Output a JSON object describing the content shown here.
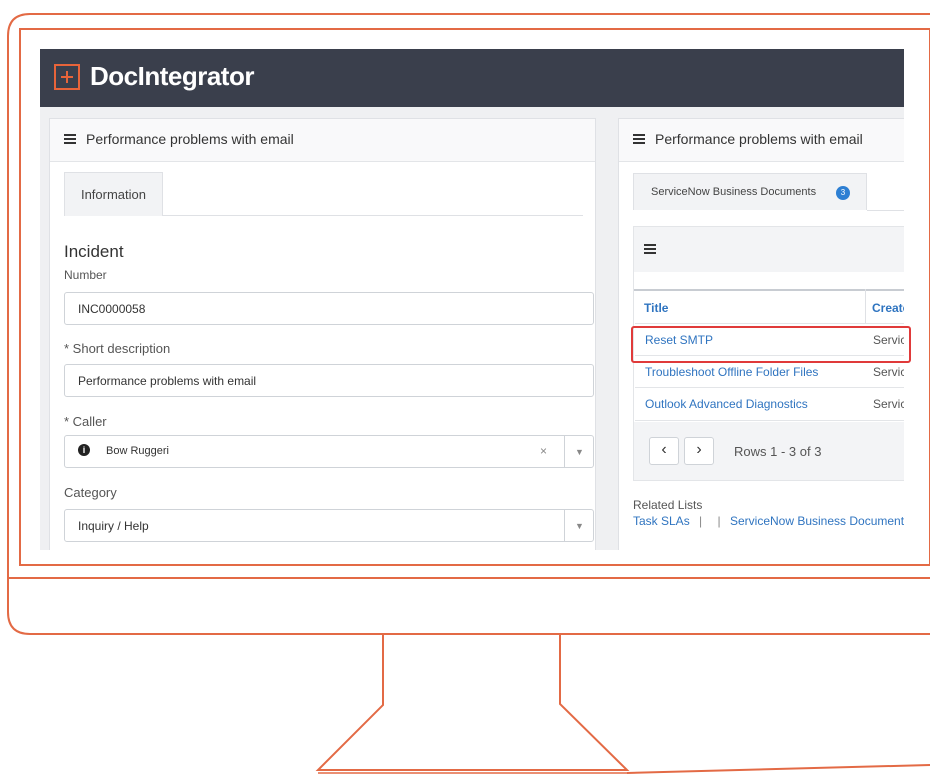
{
  "app": {
    "brand": "DocIntegrator"
  },
  "left_panel": {
    "title": "Performance problems with email",
    "tab": "Information",
    "section_title": "Incident",
    "fields": {
      "number": {
        "label": "Number",
        "value": "INC0000058"
      },
      "short_description": {
        "label": "* Short description",
        "value": "Performance problems with email"
      },
      "caller": {
        "label": "* Caller",
        "value": "Bow Ruggeri"
      },
      "category": {
        "label": "Category",
        "value": "Inquiry / Help"
      }
    }
  },
  "right_panel": {
    "title": "Performance problems with email",
    "tab": {
      "label": "ServiceNow Business Documents",
      "badge": "3"
    },
    "table": {
      "columns": [
        "Title",
        "Create"
      ],
      "rows": [
        {
          "title": "Reset SMTP",
          "created_by": "Servic",
          "highlighted": true
        },
        {
          "title": "Troubleshoot Offline Folder Files",
          "created_by": "Servic",
          "highlighted": false
        },
        {
          "title": "Outlook Advanced Diagnostics",
          "created_by": "Servic",
          "highlighted": false
        }
      ],
      "pagination": "Rows 1 - 3 of 3"
    },
    "related_lists": {
      "heading": "Related Lists",
      "links": [
        "Task SLAs",
        "ServiceNow Business Document"
      ],
      "separator": "|"
    }
  },
  "colors": {
    "accent": "#e8643a",
    "header_bg": "#3a3f4c",
    "link": "#2f74c0",
    "badge": "#2d7fd3",
    "highlight": "#e03a3a"
  },
  "icons": {
    "menu": "hamburger-icon",
    "logo": "plus-box-icon",
    "info": "info-icon",
    "clear": "close-icon",
    "dropdown": "chevron-down-icon",
    "prev": "chevron-left-icon",
    "next": "chevron-right-icon"
  }
}
